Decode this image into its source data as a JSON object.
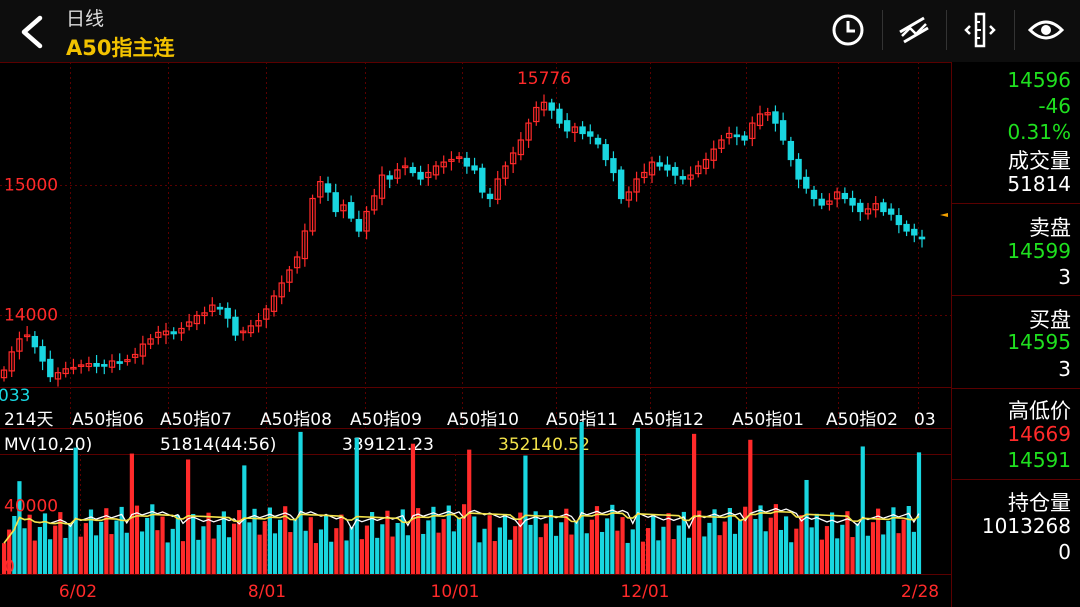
{
  "header": {
    "period": "日线",
    "instrument": "A50指主连",
    "icons": [
      "back-arrow-icon",
      "clock-icon",
      "drawing-tool-icon",
      "ruler-icon",
      "eye-icon"
    ]
  },
  "chart_data": {
    "type": "candlestick",
    "price_axis_labels": [
      "15000",
      "14000"
    ],
    "price_axis_values": [
      15000,
      14000
    ],
    "high_marker": "15776",
    "low_marker_partial": "033",
    "day_count": "214天",
    "contract_labels": [
      "A50指06",
      "A50指07",
      "A50指08",
      "A50指09",
      "A50指10",
      "A50指11",
      "A50指12",
      "A50指01",
      "A50指02",
      "03"
    ],
    "volume_indicator": "MV(10,20)",
    "volume_value": "51814(44:56)",
    "mv10_value": "339121.23",
    "mv20_value": "352140.52",
    "volume_axis_labels": [
      "40000",
      "0"
    ],
    "date_labels": [
      "6/02",
      "8/01",
      "10/01",
      "12/01",
      "2/28"
    ],
    "closes": [
      13580,
      13720,
      13820,
      13850,
      13760,
      13650,
      13530,
      13560,
      13590,
      13600,
      13620,
      13630,
      13610,
      13620,
      13650,
      13640,
      13660,
      13700,
      13780,
      13820,
      13870,
      13880,
      13860,
      13900,
      13950,
      14000,
      14020,
      14080,
      14060,
      13980,
      13850,
      13880,
      13920,
      13960,
      14050,
      14150,
      14250,
      14350,
      14450,
      14650,
      14900,
      15030,
      14950,
      14800,
      14850,
      14750,
      14650,
      14800,
      14920,
      15080,
      15050,
      15120,
      15150,
      15100,
      15050,
      15100,
      15150,
      15180,
      15200,
      15220,
      15150,
      15120,
      14950,
      14900,
      15050,
      15150,
      15250,
      15350,
      15480,
      15600,
      15640,
      15580,
      15480,
      15420,
      15450,
      15400,
      15380,
      15320,
      15200,
      15100,
      14900,
      14950,
      15050,
      15100,
      15180,
      15150,
      15120,
      15080,
      15050,
      15080,
      15150,
      15200,
      15280,
      15350,
      15400,
      15380,
      15350,
      15480,
      15550,
      15560,
      15480,
      15350,
      15200,
      15050,
      14980,
      14900,
      14850,
      14880,
      14950,
      14900,
      14850,
      14800,
      14820,
      14860,
      14800,
      14780,
      14700,
      14650,
      14620,
      14596
    ],
    "volume_scale": "volume bars red/cyan with MV10 white and MV20 yellow lines"
  },
  "price_panel": {
    "last": "14596",
    "change": "-46",
    "change_pct": "0.31%",
    "volume_label": "成交量",
    "volume": "51814",
    "ask_label": "卖盘",
    "ask_price": "14599",
    "ask_size": "3",
    "bid_label": "买盘",
    "bid_price": "14595",
    "bid_size": "3",
    "hilo_label": "高低价",
    "high": "14669",
    "low": "14591",
    "oi_label": "持仓量",
    "open_interest": "1013268",
    "oi_change": "0"
  },
  "colors": {
    "up": "#ff2a2a",
    "down": "#19d6e0",
    "mv10": "#ffffff",
    "mv20": "#f2e24a",
    "grid": "#5a0000",
    "accent": "#f2c200",
    "green": "#1fe01f"
  }
}
